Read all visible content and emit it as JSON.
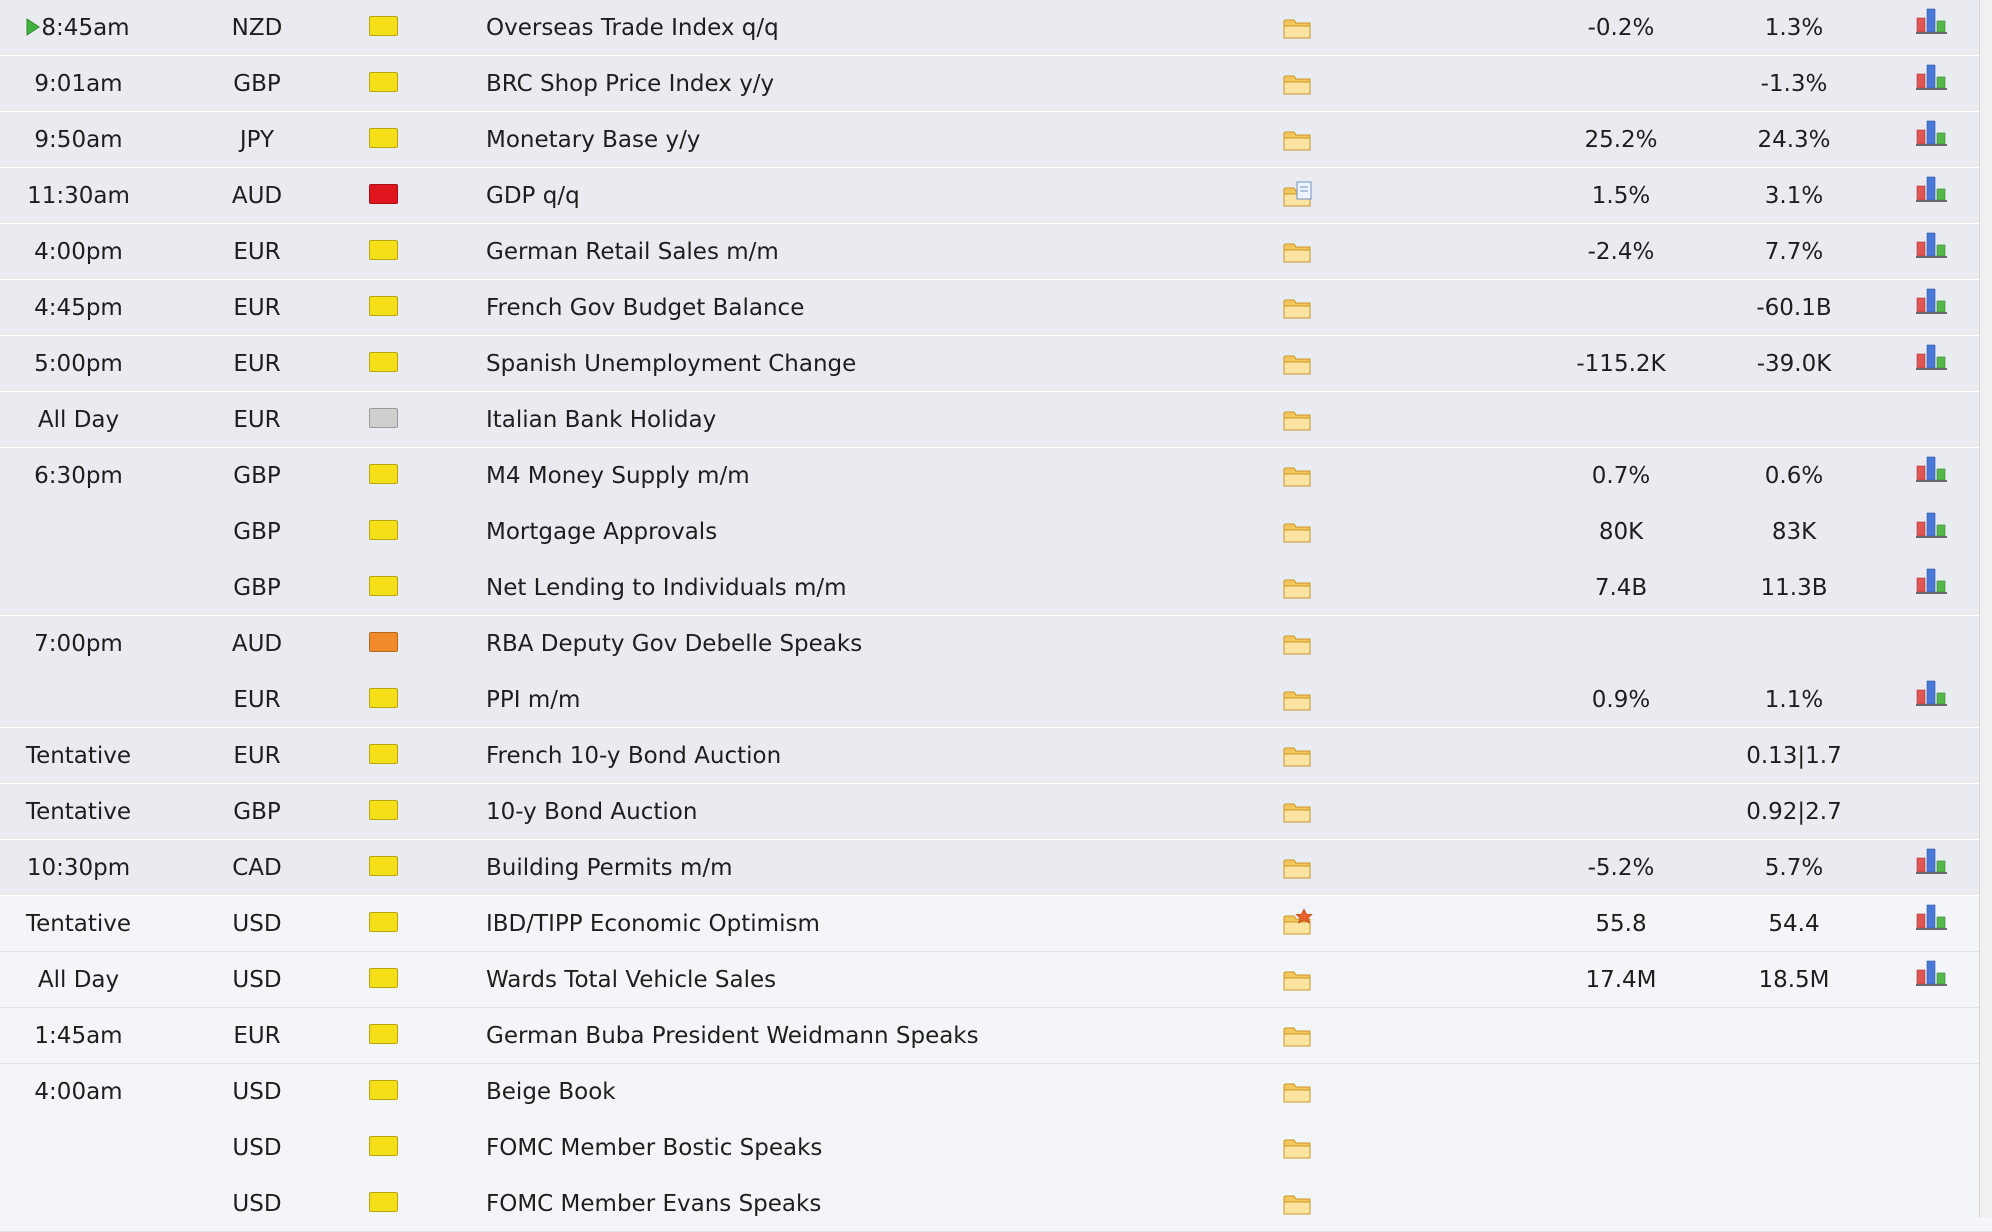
{
  "colors": {
    "impact_low": "#f5df18",
    "impact_medium": "#f08a2a",
    "impact_high": "#e0161e",
    "impact_none": "#cfcfcf"
  },
  "rows": [
    {
      "time": "8:45am",
      "currency": "NZD",
      "impact": "low",
      "event": "Overseas Trade Index q/q",
      "detail_icon": "folder-icon",
      "actual": "-0.2%",
      "previous": "1.3%",
      "graph": true,
      "next": true
    },
    {
      "time": "9:01am",
      "currency": "GBP",
      "impact": "low",
      "event": "BRC Shop Price Index y/y",
      "detail_icon": "folder-icon",
      "actual": "",
      "previous": "-1.3%",
      "graph": true
    },
    {
      "time": "9:50am",
      "currency": "JPY",
      "impact": "low",
      "event": "Monetary Base y/y",
      "detail_icon": "folder-icon",
      "actual": "25.2%",
      "previous": "24.3%",
      "graph": true
    },
    {
      "time": "11:30am",
      "currency": "AUD",
      "impact": "high",
      "event": "GDP q/q",
      "detail_icon": "folder-doc-icon",
      "actual": "1.5%",
      "previous": "3.1%",
      "graph": true
    },
    {
      "time": "4:00pm",
      "currency": "EUR",
      "impact": "low",
      "event": "German Retail Sales m/m",
      "detail_icon": "folder-icon",
      "actual": "-2.4%",
      "previous": "7.7%",
      "graph": true
    },
    {
      "time": "4:45pm",
      "currency": "EUR",
      "impact": "low",
      "event": "French Gov Budget Balance",
      "detail_icon": "folder-icon",
      "actual": "",
      "previous": "-60.1B",
      "graph": true
    },
    {
      "time": "5:00pm",
      "currency": "EUR",
      "impact": "low",
      "event": "Spanish Unemployment Change",
      "detail_icon": "folder-icon",
      "actual": "-115.2K",
      "previous": "-39.0K",
      "graph": true
    },
    {
      "time": "All Day",
      "currency": "EUR",
      "impact": "none",
      "event": "Italian Bank Holiday",
      "detail_icon": "folder-icon",
      "actual": "",
      "previous": "",
      "graph": false
    },
    {
      "time": "6:30pm",
      "currency": "GBP",
      "impact": "low",
      "event": "M4 Money Supply m/m",
      "detail_icon": "folder-icon",
      "actual": "0.7%",
      "previous": "0.6%",
      "graph": true
    },
    {
      "time": "",
      "currency": "GBP",
      "impact": "low",
      "event": "Mortgage Approvals",
      "detail_icon": "folder-icon",
      "actual": "80K",
      "previous": "83K",
      "graph": true
    },
    {
      "time": "",
      "currency": "GBP",
      "impact": "low",
      "event": "Net Lending to Individuals m/m",
      "detail_icon": "folder-icon",
      "actual": "7.4B",
      "previous": "11.3B",
      "graph": true
    },
    {
      "time": "7:00pm",
      "currency": "AUD",
      "impact": "medium",
      "event": "RBA Deputy Gov Debelle Speaks",
      "detail_icon": "folder-icon",
      "actual": "",
      "previous": "",
      "graph": false
    },
    {
      "time": "",
      "currency": "EUR",
      "impact": "low",
      "event": "PPI m/m",
      "detail_icon": "folder-icon",
      "actual": "0.9%",
      "previous": "1.1%",
      "graph": true
    },
    {
      "time": "Tentative",
      "currency": "EUR",
      "impact": "low",
      "event": "French 10-y Bond Auction",
      "detail_icon": "folder-icon",
      "actual": "",
      "previous": "0.13|1.7",
      "graph": false
    },
    {
      "time": "Tentative",
      "currency": "GBP",
      "impact": "low",
      "event": "10-y Bond Auction",
      "detail_icon": "folder-icon",
      "actual": "",
      "previous": "0.92|2.7",
      "graph": false
    },
    {
      "time": "10:30pm",
      "currency": "CAD",
      "impact": "low",
      "event": "Building Permits m/m",
      "detail_icon": "folder-icon",
      "actual": "-5.2%",
      "previous": "5.7%",
      "graph": true
    },
    {
      "time": "Tentative",
      "currency": "USD",
      "impact": "low",
      "event": "IBD/TIPP Economic Optimism",
      "detail_icon": "folder-star-icon",
      "actual": "55.8",
      "previous": "54.4",
      "graph": true,
      "after": true
    },
    {
      "time": "All Day",
      "currency": "USD",
      "impact": "low",
      "event": "Wards Total Vehicle Sales",
      "detail_icon": "folder-icon",
      "actual": "17.4M",
      "previous": "18.5M",
      "graph": true,
      "after": true
    },
    {
      "time": "1:45am",
      "currency": "EUR",
      "impact": "low",
      "event": "German Buba President Weidmann Speaks",
      "detail_icon": "folder-icon",
      "actual": "",
      "previous": "",
      "graph": false,
      "after": true
    },
    {
      "time": "4:00am",
      "currency": "USD",
      "impact": "low",
      "event": "Beige Book",
      "detail_icon": "folder-icon",
      "actual": "",
      "previous": "",
      "graph": false,
      "after": true
    },
    {
      "time": "",
      "currency": "USD",
      "impact": "low",
      "event": "FOMC Member Bostic Speaks",
      "detail_icon": "folder-icon",
      "actual": "",
      "previous": "",
      "graph": false,
      "after": true
    },
    {
      "time": "",
      "currency": "USD",
      "impact": "low",
      "event": "FOMC Member Evans Speaks",
      "detail_icon": "folder-icon",
      "actual": "",
      "previous": "",
      "graph": false,
      "after": true
    }
  ]
}
